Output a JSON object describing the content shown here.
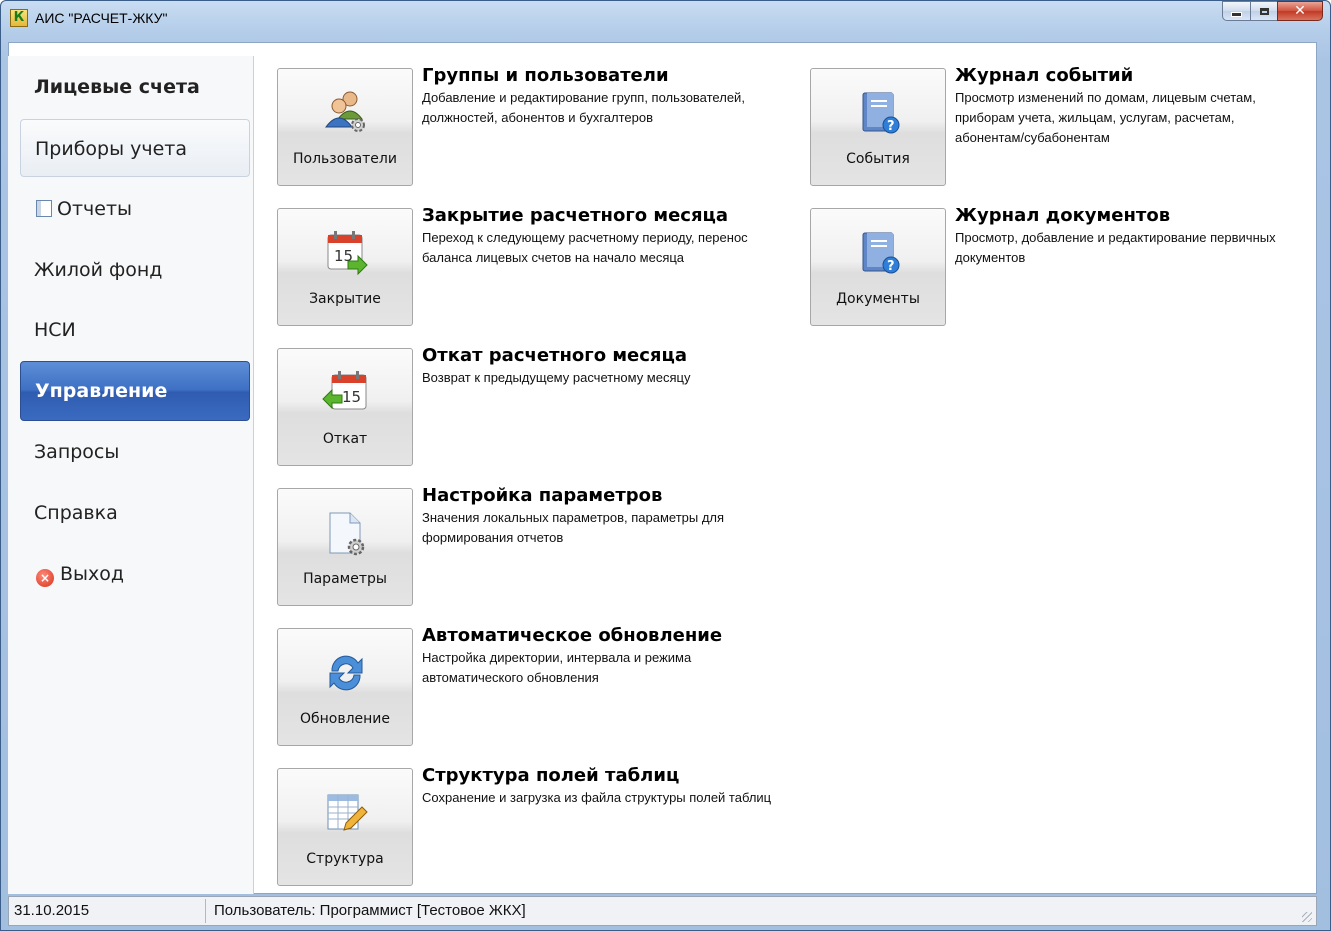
{
  "window": {
    "title": "АИС \"РАСЧЕТ-ЖКУ\"",
    "app_icon_letter": "К"
  },
  "sidebar": {
    "items": [
      {
        "label": "Лицевые счета",
        "state": "header"
      },
      {
        "label": "Приборы учета",
        "state": "hover"
      },
      {
        "label": "Отчеты",
        "icon": "report-icon"
      },
      {
        "label": "Жилой фонд"
      },
      {
        "label": "НСИ"
      },
      {
        "label": "Управление",
        "state": "active"
      },
      {
        "label": "Запросы"
      },
      {
        "label": "Справка"
      },
      {
        "label": "Выход",
        "icon": "exit-icon"
      }
    ]
  },
  "tiles": [
    {
      "button": "Пользователи",
      "title": "Группы и пользователи",
      "description": "Добавление и редактирование групп, пользователей, должностей, абонентов и бухгалтеров",
      "icon": "users-icon"
    },
    {
      "button": "Закрытие",
      "title": "Закрытие расчетного месяца",
      "description": "Переход к следующему расчетному периоду, перенос баланса лицевых счетов на начало месяца",
      "icon": "calendar-forward-icon"
    },
    {
      "button": "Откат",
      "title": "Откат расчетного месяца",
      "description": "Возврат к предыдущему расчетному месяцу",
      "icon": "calendar-back-icon"
    },
    {
      "button": "Параметры",
      "title": "Настройка параметров",
      "description": "Значения локальных параметров, параметры для формирования отчетов",
      "icon": "settings-document-icon"
    },
    {
      "button": "Обновление",
      "title": "Автоматическое обновление",
      "description": "Настройка директории, интервала и режима автоматического обновления",
      "icon": "refresh-icon"
    },
    {
      "button": "Структура",
      "title": "Структура полей таблиц",
      "description": "Сохранение и загрузка из файла структуры полей таблиц",
      "icon": "table-structure-icon"
    },
    {
      "button": "События",
      "title": "Журнал событий",
      "description": "Просмотр изменений по домам, лицевым счетам, приборам учета, жильцам, услугам, расчетам, абонентам/субабонентам",
      "icon": "help-book-icon"
    },
    {
      "button": "Документы",
      "title": "Журнал документов",
      "description": "Просмотр, добавление и редактирование первичных документов",
      "icon": "help-book-icon"
    }
  ],
  "statusbar": {
    "date": "31.10.2015",
    "user": "Пользователь: Программист [Тестовое ЖКХ]"
  },
  "colors": {
    "active_nav": "#3e70c4",
    "title_bar": "#b4cde9"
  }
}
